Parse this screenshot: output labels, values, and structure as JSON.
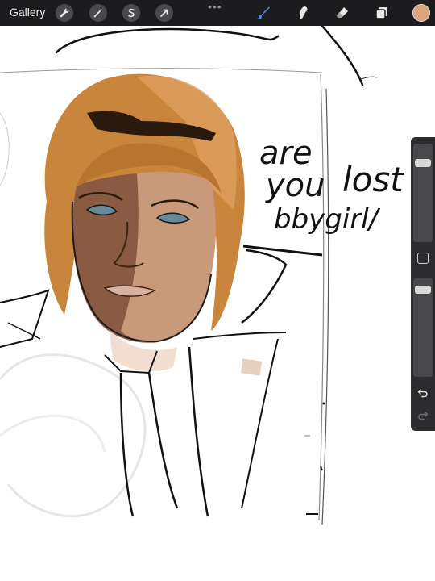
{
  "toolbar": {
    "gallery_label": "Gallery",
    "more_glyph": "•••",
    "left_tools": [
      {
        "name": "wrench-icon",
        "label": "Actions"
      },
      {
        "name": "magic-wand-icon",
        "label": "Adjustments"
      },
      {
        "name": "selection-icon",
        "label": "Selection"
      },
      {
        "name": "transform-arrow-icon",
        "label": "Transform"
      }
    ],
    "right_tools": [
      {
        "name": "brush-icon",
        "active": true
      },
      {
        "name": "smudge-icon",
        "active": false
      },
      {
        "name": "eraser-icon",
        "active": false
      },
      {
        "name": "layers-icon",
        "active": false
      }
    ],
    "active_color": "#d9a47f"
  },
  "sidebar": {
    "brush_size": 0.17,
    "opacity": 0.08,
    "undo_icon": "undo-icon",
    "redo_icon": "redo-icon"
  },
  "canvas": {
    "text_lines": [
      "are",
      "you",
      "lost",
      "bbygirl/"
    ]
  },
  "colors": {
    "toolbar_bg": "#1c1c1e",
    "active_brush": "#4a90ff",
    "hair": "#c8853b",
    "skin_dark": "#8a5a42",
    "skin_light": "#c99a7a"
  }
}
